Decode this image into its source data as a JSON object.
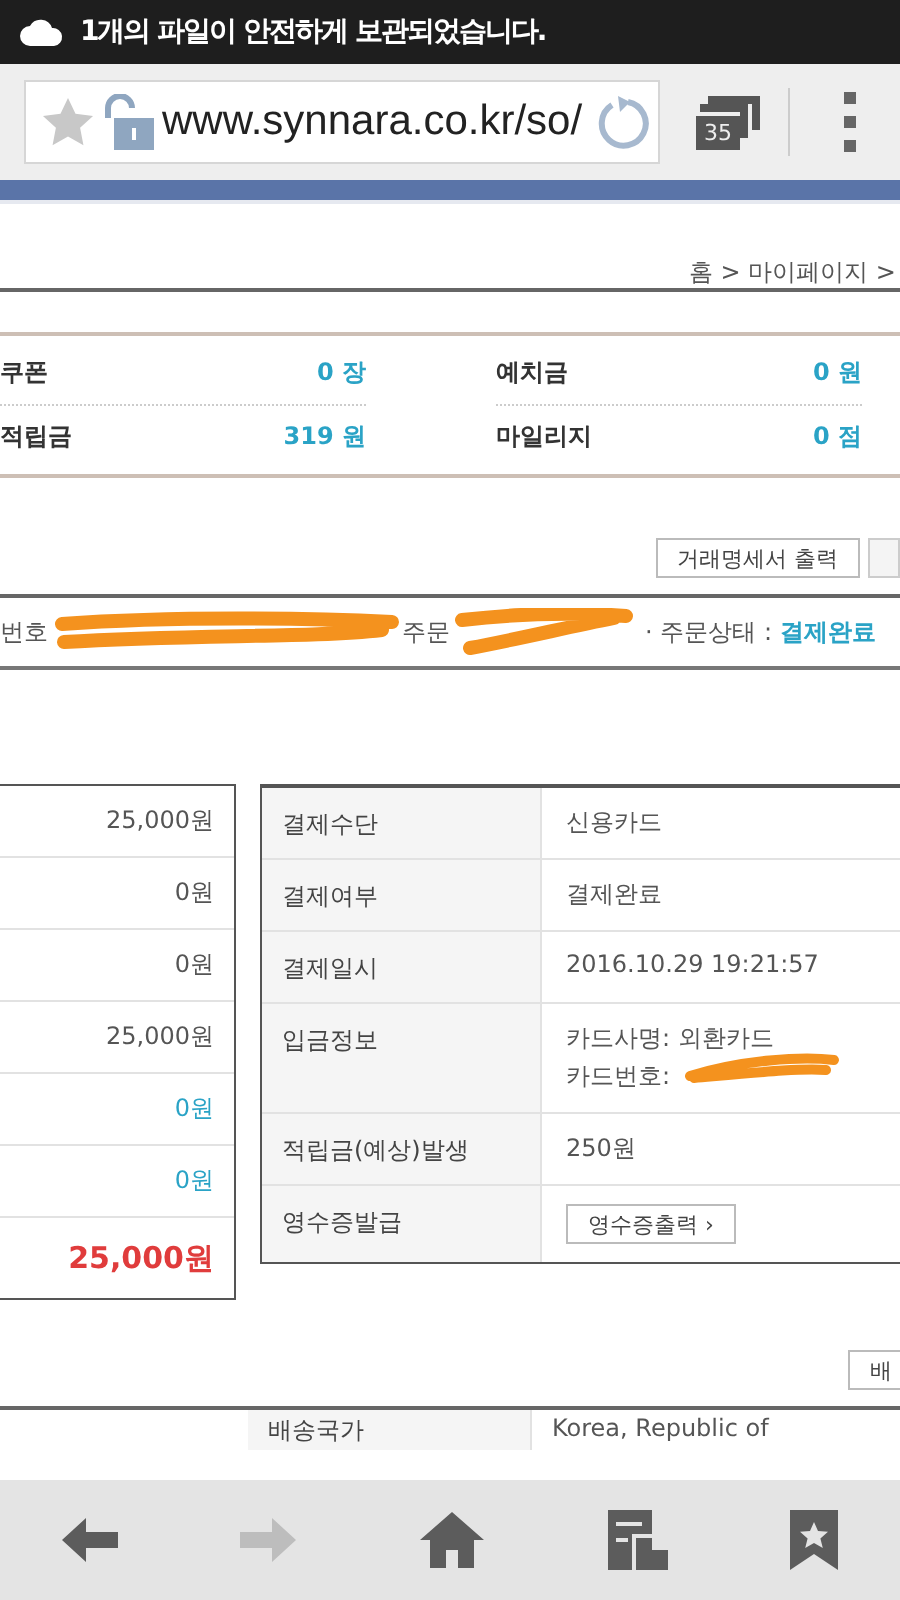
{
  "status_bar": {
    "notification": "1개의 파일이 안전하게 보관되었습니다."
  },
  "browser": {
    "url": "www.synnara.co.kr/so/",
    "tab_count": "35"
  },
  "breadcrumb": "홈 > 마이페이지 >",
  "summary": [
    {
      "label": "쿠폰",
      "value": "0 장"
    },
    {
      "label": "예치금",
      "value": "0 원"
    },
    {
      "label": "적립금",
      "value": "319 원"
    },
    {
      "label": "마일리지",
      "value": "0 점"
    }
  ],
  "action_buttons": [
    "거래명세서 출력"
  ],
  "order_info": {
    "number_label": "번호",
    "date_label": "주문",
    "status_label": "· 주문상태 :",
    "status": "결제완료"
  },
  "amounts": [
    {
      "value": "25,000원",
      "kind": "plain"
    },
    {
      "value": "0원",
      "kind": "plain"
    },
    {
      "value": "0원",
      "kind": "plain"
    },
    {
      "value": "25,000원",
      "kind": "plain"
    },
    {
      "value": "0원",
      "kind": "discount"
    },
    {
      "value": "0원",
      "kind": "discount"
    },
    {
      "value": "25,000원",
      "kind": "total"
    }
  ],
  "payment": [
    {
      "label": "결제수단",
      "lines": [
        "신용카드"
      ]
    },
    {
      "label": "결제여부",
      "lines": [
        "결제완료"
      ]
    },
    {
      "label": "결제일시",
      "lines": [
        "2016.10.29 19:21:57"
      ]
    },
    {
      "label": "입금정보",
      "lines": [
        "카드사명: 외환카드",
        "카드번호:"
      ],
      "redacted": true
    },
    {
      "label": "적립금(예상)발생",
      "lines": [
        "250원"
      ]
    },
    {
      "label": "영수증발급",
      "button": "영수증출력 ›"
    }
  ],
  "shipping_button": "배",
  "shipping": [
    {
      "label": "배송국가",
      "value": "Korea, Republic of"
    }
  ],
  "toolbar": [
    {
      "kind": "back",
      "disabled": false
    },
    {
      "kind": "forward",
      "disabled": true
    },
    {
      "kind": "home",
      "disabled": false
    },
    {
      "kind": "tabs",
      "disabled": false
    },
    {
      "kind": "bookmarks",
      "disabled": false
    }
  ]
}
